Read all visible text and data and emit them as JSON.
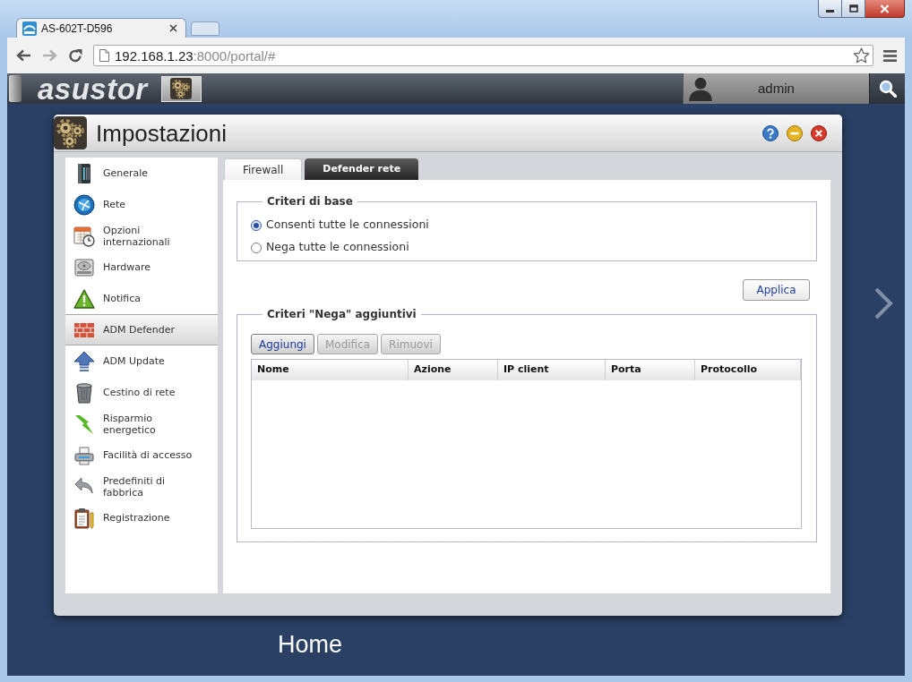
{
  "browser": {
    "tabs": [
      {
        "title": "AS-602T-D596",
        "selected": true
      }
    ],
    "back": {
      "disabled": false
    },
    "forward": {
      "disabled": true
    },
    "address": {
      "host": "192.168.1.23",
      "path": ":8000/portal/#"
    }
  },
  "top_bar": {
    "logo": "asustor",
    "user": "admin"
  },
  "window": {
    "title": "Impostazioni",
    "sidebar": {
      "items": [
        {
          "label": "Generale",
          "selected": false
        },
        {
          "label": "Rete",
          "selected": false
        },
        {
          "label": "Opzioni internazionali",
          "selected": false
        },
        {
          "label": "Hardware",
          "selected": false
        },
        {
          "label": "Notifica",
          "selected": false
        },
        {
          "label": "ADM Defender",
          "selected": true
        },
        {
          "label": "ADM Update",
          "selected": false
        },
        {
          "label": "Cestino di rete",
          "selected": false
        },
        {
          "label": "Risparmio energetico",
          "selected": false
        },
        {
          "label": "Facilità di accesso",
          "selected": false
        },
        {
          "label": "Predefiniti di fabbrica",
          "selected": false
        },
        {
          "label": "Registrazione",
          "selected": false
        }
      ]
    },
    "tabs": [
      {
        "label": "Firewall",
        "selected": true
      },
      {
        "label": "Defender rete",
        "selected": false
      }
    ],
    "basic_policy": {
      "legend": "Criteri di base",
      "options": [
        {
          "label": "Consenti tutte le connessioni",
          "selected": true
        },
        {
          "label": "Nega tutte le connessioni",
          "selected": false
        }
      ]
    },
    "apply_button": "Applica",
    "deny_rules": {
      "legend": "Criteri \"Nega\" aggiuntivi",
      "buttons": [
        {
          "label": "Aggiungi",
          "disabled": false
        },
        {
          "label": "Modifica",
          "disabled": true
        },
        {
          "label": "Rimuovi",
          "disabled": true
        }
      ],
      "table": {
        "columns": [
          "Nome",
          "Azione",
          "IP client",
          "Porta",
          "Protocollo"
        ]
      }
    }
  },
  "desktop": {
    "page_label": "Home"
  }
}
